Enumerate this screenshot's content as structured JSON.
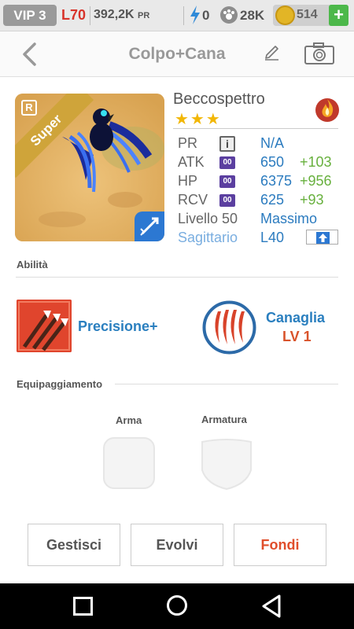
{
  "statusbar": {
    "vip": "VIP 3",
    "level": "L70",
    "power_value": "392,2K",
    "power_unit": "PR",
    "energy": "0",
    "food": "28K",
    "coins": "514",
    "add_label": "+"
  },
  "header": {
    "title": "Colpo+Cana",
    "back_icon": "chevron-left-icon",
    "edit_icon": "pencil-icon",
    "camera_icon": "camera-icon"
  },
  "pet": {
    "rarity_badge": "R",
    "ribbon": "Super",
    "name": "Beccospettro",
    "stars": "★★★",
    "element_icon": "flame-icon",
    "class_icon": "archer-icon",
    "stats": [
      {
        "label": "PR",
        "value": "N/A",
        "bonus": ""
      },
      {
        "label": "ATK",
        "value": "650",
        "bonus": "+103",
        "badge": "00"
      },
      {
        "label": "HP",
        "value": "6375",
        "bonus": "+956",
        "badge": "00"
      },
      {
        "label": "RCV",
        "value": "625",
        "bonus": "+93",
        "badge": "00"
      }
    ],
    "info_icon": "i",
    "level_label": "Livello 50",
    "level_value": "Massimo",
    "class_name": "Sagittario",
    "class_level": "L40"
  },
  "abilities": {
    "section_title": "Abilità",
    "skill1": {
      "name": "Precisione+",
      "icon": "arrows-icon"
    },
    "skill2": {
      "name": "Canaglia",
      "level": "LV 1",
      "icon": "claw-icon"
    }
  },
  "equipment": {
    "section_title": "Equipaggiamento",
    "weapon_label": "Arma",
    "armor_label": "Armatura"
  },
  "buttons": {
    "manage": "Gestisci",
    "evolve": "Evolvi",
    "merge": "Fondi"
  },
  "colors": {
    "accent_blue": "#2a7fbf",
    "bonus_green": "#67b03d",
    "accent_orange": "#e04e2b",
    "level_red": "#d8332a"
  }
}
